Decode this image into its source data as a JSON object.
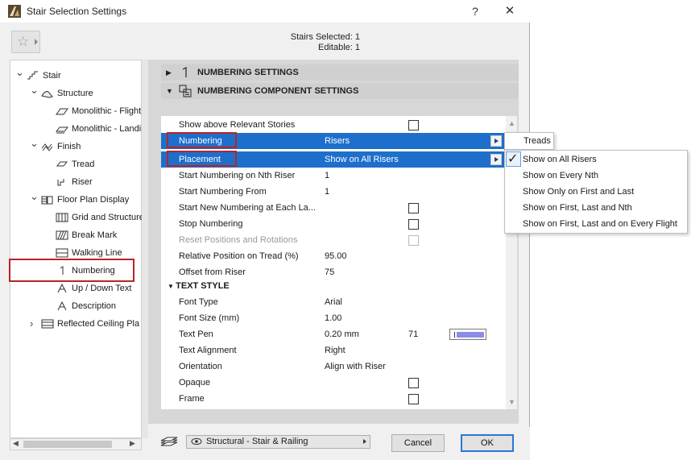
{
  "window": {
    "title": "Stair Selection Settings",
    "help_label": "?",
    "close_label": "✕"
  },
  "selection_info": {
    "selected": "Stairs Selected: 1",
    "editable": "Editable: 1"
  },
  "tree": {
    "items": [
      {
        "label": "Stair",
        "icon": "stair-icon",
        "expand": "open"
      },
      {
        "label": "Structure",
        "icon": "structure-icon",
        "expand": "open"
      },
      {
        "label": "Monolithic - Flight",
        "icon": "monolithic-flight-icon",
        "expand": "none"
      },
      {
        "label": "Monolithic - Landi",
        "icon": "monolithic-landing-icon",
        "expand": "none"
      },
      {
        "label": "Finish",
        "icon": "finish-icon",
        "expand": "open"
      },
      {
        "label": "Tread",
        "icon": "tread-icon",
        "expand": "none"
      },
      {
        "label": "Riser",
        "icon": "riser-icon",
        "expand": "none"
      },
      {
        "label": "Floor Plan Display",
        "icon": "floor-plan-icon",
        "expand": "open"
      },
      {
        "label": "Grid and Structure",
        "icon": "grid-icon",
        "expand": "none"
      },
      {
        "label": "Break Mark",
        "icon": "break-mark-icon",
        "expand": "none"
      },
      {
        "label": "Walking Line",
        "icon": "walking-line-icon",
        "expand": "none"
      },
      {
        "label": "Numbering",
        "icon": "numbering-icon",
        "expand": "none"
      },
      {
        "label": "Up / Down Text",
        "icon": "up-down-text-icon",
        "expand": "none"
      },
      {
        "label": "Description",
        "icon": "description-icon",
        "expand": "none"
      },
      {
        "label": "Reflected Ceiling Pla",
        "icon": "ceiling-plan-icon",
        "expand": "closed"
      }
    ]
  },
  "sections": {
    "numbering_settings": "NUMBERING SETTINGS",
    "numbering_component_settings": "NUMBERING COMPONENT SETTINGS"
  },
  "properties": {
    "show_above": {
      "label": "Show above Relevant Stories"
    },
    "numbering": {
      "label": "Numbering",
      "value": "Risers"
    },
    "placement": {
      "label": "Placement",
      "value": "Show on All Risers"
    },
    "start_nth": {
      "label": "Start Numbering on Nth Riser",
      "value": "1"
    },
    "start_from": {
      "label": "Start Numbering From",
      "value": "1"
    },
    "start_new": {
      "label": "Start New Numbering at Each La..."
    },
    "stop": {
      "label": "Stop Numbering"
    },
    "reset": {
      "label": "Reset Positions and Rotations"
    },
    "rel_pos": {
      "label": "Relative Position on Tread (%)",
      "value": "95.00"
    },
    "offset": {
      "label": "Offset from Riser",
      "value": "75"
    },
    "text_style_header": "TEXT STYLE",
    "font_type": {
      "label": "Font Type",
      "value": "Arial"
    },
    "font_size": {
      "label": "Font Size (mm)",
      "value": "1.00"
    },
    "text_pen": {
      "label": "Text Pen",
      "value": "0.20 mm",
      "pen_number": "71",
      "pen_color": "#8c8ce8"
    },
    "text_alignment": {
      "label": "Text Alignment",
      "value": "Right"
    },
    "orientation": {
      "label": "Orientation",
      "value": "Align with Riser"
    },
    "opaque": {
      "label": "Opaque"
    },
    "frame": {
      "label": "Frame"
    }
  },
  "numbering_popup": {
    "option": "Treads"
  },
  "placement_popup": {
    "options": [
      "Show on All Risers",
      "Show on Every Nth",
      "Show Only on First and Last",
      "Show on First, Last and Nth",
      "Show on First, Last and on Every Flight"
    ],
    "checked_index": 0
  },
  "footer": {
    "layer": "Structural - Stair & Railing",
    "cancel_label": "Cancel",
    "ok_label": "OK"
  },
  "colors": {
    "selection_blue": "#1e6fcc",
    "highlight_red": "#b8232a"
  }
}
